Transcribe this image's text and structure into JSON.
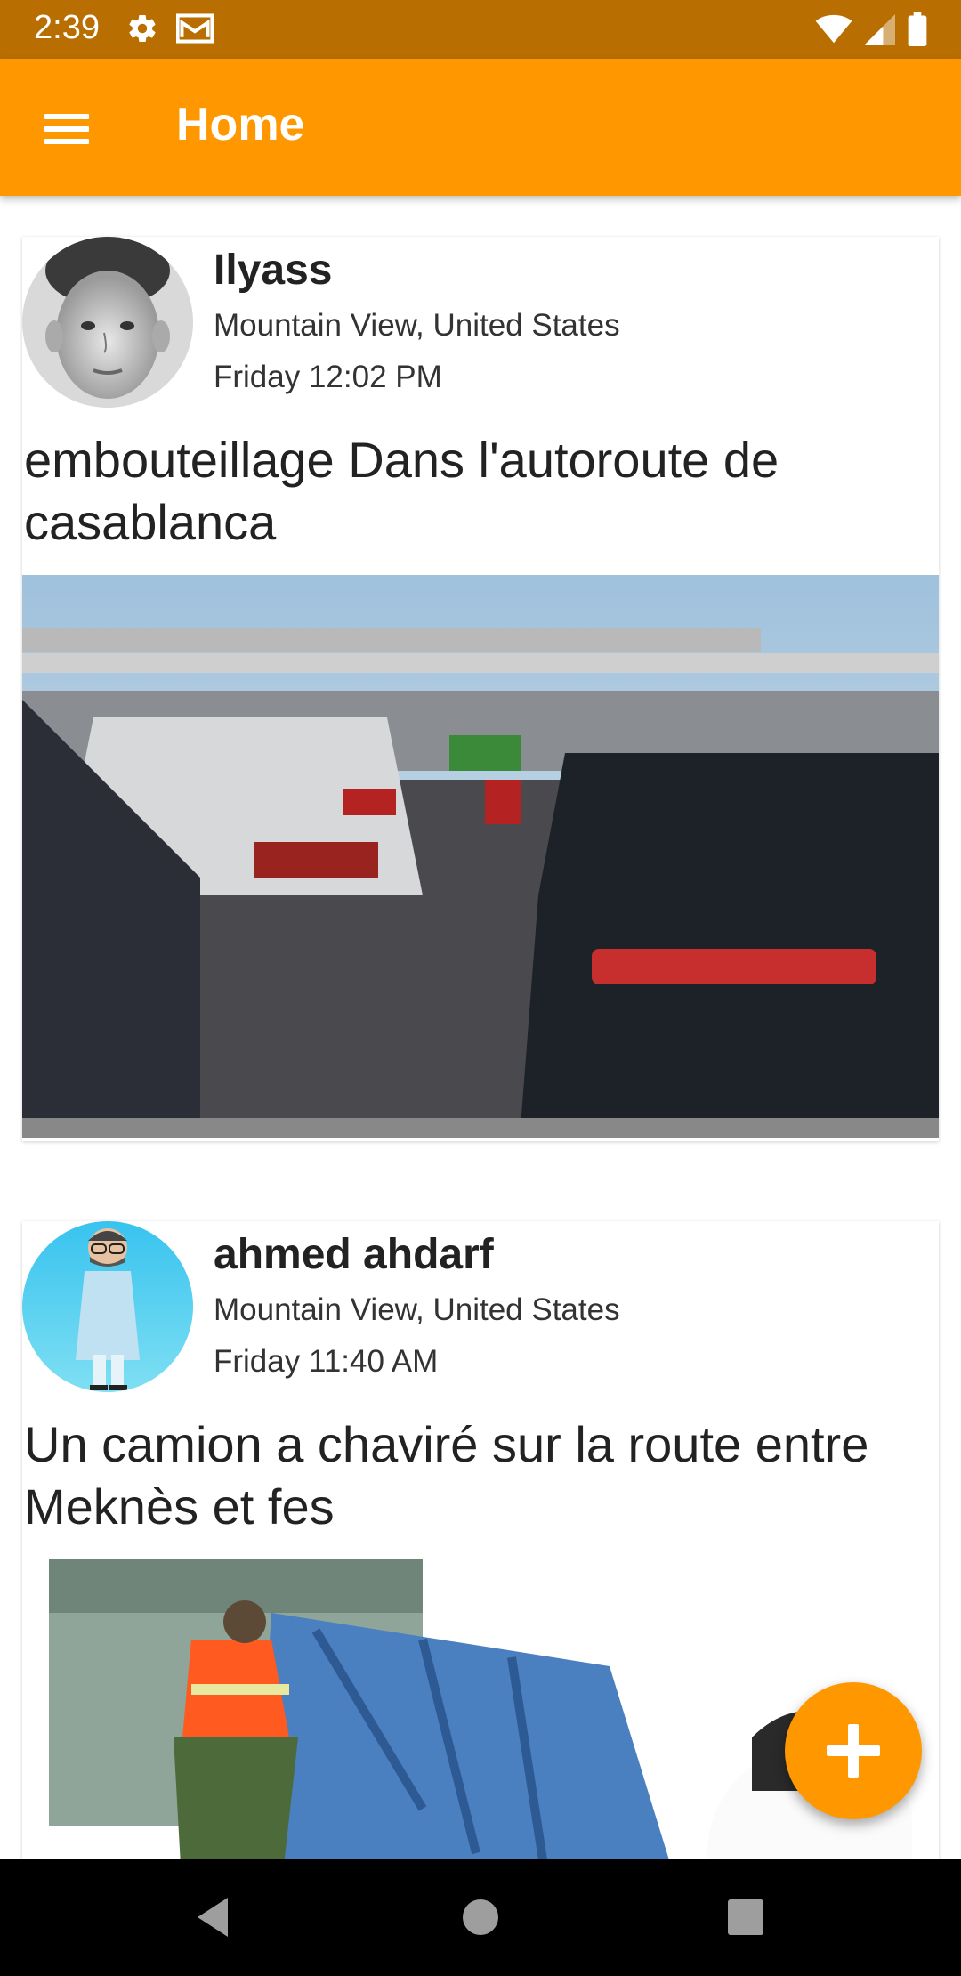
{
  "status_bar": {
    "time": "2:39",
    "left_icons": [
      "settings-icon",
      "mail-icon"
    ],
    "right_icons": [
      "wifi-icon",
      "signal-icon",
      "battery-icon"
    ],
    "background": "#b86e00"
  },
  "app_bar": {
    "title": "Home",
    "menu_icon": "menu-icon",
    "background": "#ff9800"
  },
  "posts": [
    {
      "user_name": "Ilyass",
      "location": "Mountain View, United States",
      "time": "Friday 12:02 PM",
      "text": "embouteillage Dans l'autoroute de casablanca",
      "image_icon": "traffic-photo"
    },
    {
      "user_name": "ahmed ahdarf",
      "location": "Mountain View, United States",
      "time": "Friday 11:40 AM",
      "text": "Un camion a chaviré sur la route entre Meknès et fes",
      "image_icon": "truck-accident-photo"
    }
  ],
  "fab": {
    "icon": "add-icon",
    "color": "#ff9800"
  },
  "nav_bar": {
    "icons": [
      "back-icon",
      "home-icon",
      "recents-icon"
    ]
  }
}
